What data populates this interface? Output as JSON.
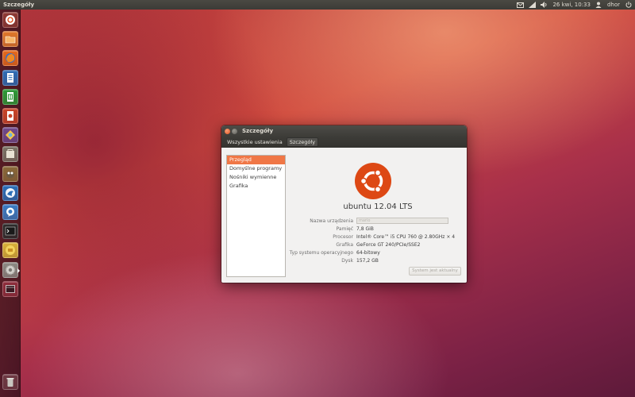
{
  "top_panel": {
    "app_title": "Szczegóły",
    "datetime": "26 kwi, 10:33",
    "user": "dhor"
  },
  "launcher": {
    "items": [
      {
        "name": "dash-home",
        "icon": "ubuntu-logo-icon",
        "color": "#8e3a34"
      },
      {
        "name": "home-folder",
        "icon": "folder-icon",
        "color": "#e0782a"
      },
      {
        "name": "firefox",
        "icon": "firefox-icon",
        "color": "#e66a1c"
      },
      {
        "name": "libreoffice-writer",
        "icon": "writer-document-icon",
        "color": "#2f6db5"
      },
      {
        "name": "libreoffice-calc",
        "icon": "calc-spreadsheet-icon",
        "color": "#2e9a38"
      },
      {
        "name": "libreoffice-impress",
        "icon": "impress-presentation-icon",
        "color": "#c9452a"
      },
      {
        "name": "shotwell",
        "icon": "shotwell-photo-icon",
        "color": "#6f4a8c"
      },
      {
        "name": "software-center",
        "icon": "software-center-icon",
        "color": "#7b7466"
      },
      {
        "name": "gimp",
        "icon": "gimp-icon",
        "color": "#8a6a3a"
      },
      {
        "name": "thunderbird",
        "icon": "bird-icon",
        "color": "#2b6fb8"
      },
      {
        "name": "empathy",
        "icon": "chat-bubble-icon",
        "color": "#3b7cc4"
      },
      {
        "name": "terminal",
        "icon": "terminal-icon",
        "color": "#2c2c2c"
      },
      {
        "name": "transmission",
        "icon": "transmission-icon",
        "color": "#d9b23a"
      },
      {
        "name": "system-settings",
        "icon": "gear-icon",
        "color": "#8c8a84",
        "active": true
      },
      {
        "name": "workspace-switcher",
        "icon": "workspace-icon",
        "color": "#8e2d3c"
      },
      {
        "name": "trash",
        "icon": "trash-icon",
        "color": "#6e3a44"
      }
    ]
  },
  "window": {
    "title": "Szczegóły",
    "breadcrumbs": [
      "Wszystkie ustawienia",
      "Szczegóły"
    ],
    "sidebar": [
      "Przegląd",
      "Domyślne programy",
      "Nośniki wymienne",
      "Grafika"
    ],
    "selected_index": 0,
    "os_name": "ubuntu 12.04 LTS",
    "device": {
      "label": "Nazwa urządzenia",
      "value": "mario"
    },
    "rows": [
      {
        "label": "Pamięć",
        "value": "7,8 GiB"
      },
      {
        "label": "Procesor",
        "value": "Intel® Core™ i5 CPU 760 @ 2.80GHz × 4"
      },
      {
        "label": "Grafika",
        "value": "GeForce GT 240/PCIe/SSE2"
      },
      {
        "label": "Typ systemu operacyjnego",
        "value": "64-bitowy"
      },
      {
        "label": "Dysk",
        "value": "157,2 GB"
      }
    ],
    "update_button": "System jest aktualny"
  },
  "colors": {
    "accent": "#dd4814",
    "selection": "#f07746",
    "panel": "#3c3b37"
  }
}
